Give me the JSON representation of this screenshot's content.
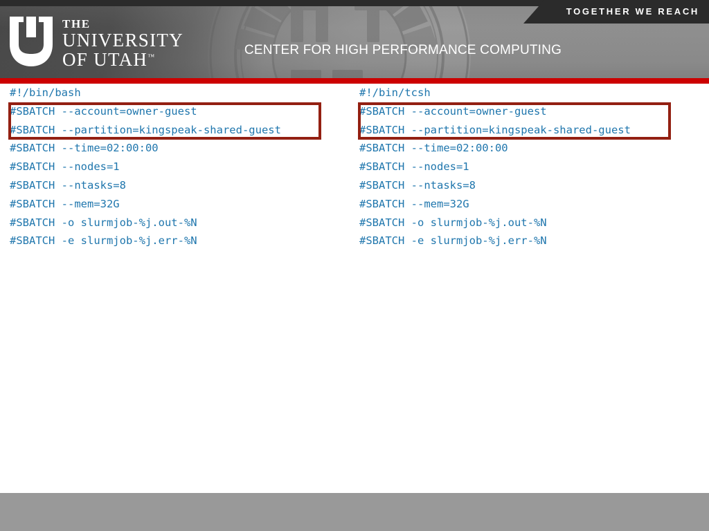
{
  "header": {
    "top_banner_text": "TOGETHER WE REACH",
    "logo": {
      "mark": "u-shield-logo",
      "line1": "THE",
      "line2": "UNIVERSITY",
      "line3": "OF UTAH",
      "trademark": "™"
    },
    "center_title": "CENTER FOR HIGH PERFORMANCE COMPUTING",
    "accent_color": "#cc0000",
    "banner_color": "#2b2b2b"
  },
  "content": {
    "code_text_color": "#1f76ad",
    "highlight_border_color": "#932012",
    "left_script": {
      "title": "bash-slurm-script",
      "lines": [
        "#!/bin/bash",
        "#SBATCH --account=owner-guest",
        "#SBATCH --partition=kingspeak-shared-guest",
        "#SBATCH --time=02:00:00",
        "#SBATCH --nodes=1",
        "#SBATCH --ntasks=8",
        "#SBATCH --mem=32G",
        "#SBATCH -o slurmjob-%j.out-%N",
        "#SBATCH -e slurmjob-%j.err-%N"
      ],
      "highlighted_lines": [
        1,
        2
      ]
    },
    "right_script": {
      "title": "tcsh-slurm-script",
      "lines": [
        "#!/bin/tcsh",
        "#SBATCH --account=owner-guest",
        "#SBATCH --partition=kingspeak-shared-guest",
        "#SBATCH --time=02:00:00",
        "#SBATCH --nodes=1",
        "#SBATCH --ntasks=8",
        "#SBATCH --mem=32G",
        "#SBATCH -o slurmjob-%j.out-%N",
        "#SBATCH -e slurmjob-%j.err-%N"
      ],
      "highlighted_lines": [
        1,
        2
      ]
    }
  },
  "footer": {
    "background_color": "#999999"
  }
}
